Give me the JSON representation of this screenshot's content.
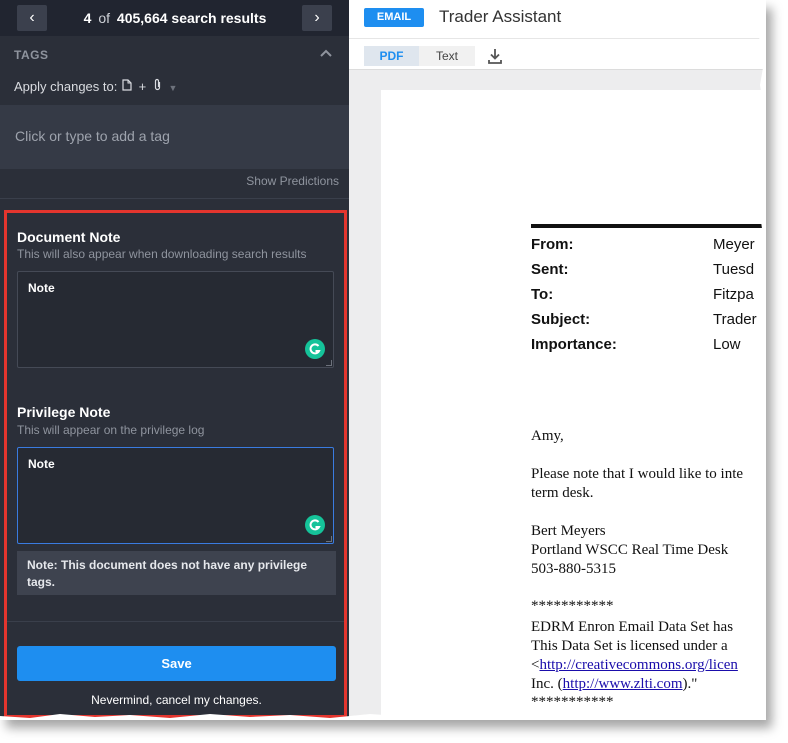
{
  "nav": {
    "prev_label": "‹",
    "next_label": "›",
    "current": "4",
    "of": "of",
    "total": "405,664",
    "suffix": "search results"
  },
  "tags": {
    "header": "TAGS",
    "apply_label": "Apply changes to:",
    "apply_plus": "+",
    "placeholder": "Click or type to add a tag",
    "show_predictions": "Show Predictions"
  },
  "document_note": {
    "title": "Document Note",
    "subtitle": "This will also appear when downloading search results",
    "value": "Note"
  },
  "privilege_note": {
    "title": "Privilege Note",
    "subtitle": "This will appear on the privilege log",
    "value": "Note",
    "warning": "Note: This document does not have any privilege tags."
  },
  "actions": {
    "save": "Save",
    "cancel": "Nevermind, cancel my changes."
  },
  "viewer": {
    "badge": "EMAIL",
    "title": "Trader Assistant",
    "tab_pdf": "PDF",
    "tab_text": "Text"
  },
  "email": {
    "headers": [
      {
        "label": "From:",
        "value": "Meyer"
      },
      {
        "label": "Sent:",
        "value": "Tuesd"
      },
      {
        "label": "To:",
        "value": "Fitzpa"
      },
      {
        "label": "Subject:",
        "value": "Trader"
      },
      {
        "label": "Importance:",
        "value": "Low"
      }
    ],
    "greeting": "Amy,",
    "body_1": "Please note that I would like to inte",
    "body_2": "term desk.",
    "sig_name": "Bert Meyers",
    "sig_desk": "Portland WSCC Real Time Desk",
    "sig_phone": "503-880-5315",
    "stars_1": "***********",
    "footer_1": "EDRM Enron Email Data Set has",
    "footer_2": "This Data Set is licensed under a",
    "footer_3_prefix": "<",
    "footer_3_link": "http://creativecommons.org/licen",
    "footer_4_prefix": "Inc. (",
    "footer_4_link": "http://www.zlti.com",
    "footer_4_suffix": ").\"",
    "stars_2": "***********"
  },
  "colors": {
    "sidebar_bg": "#2b2f39",
    "accent_blue": "#1e8ef0",
    "highlight_red": "#e4352e",
    "grammarly_green": "#15c39a"
  }
}
